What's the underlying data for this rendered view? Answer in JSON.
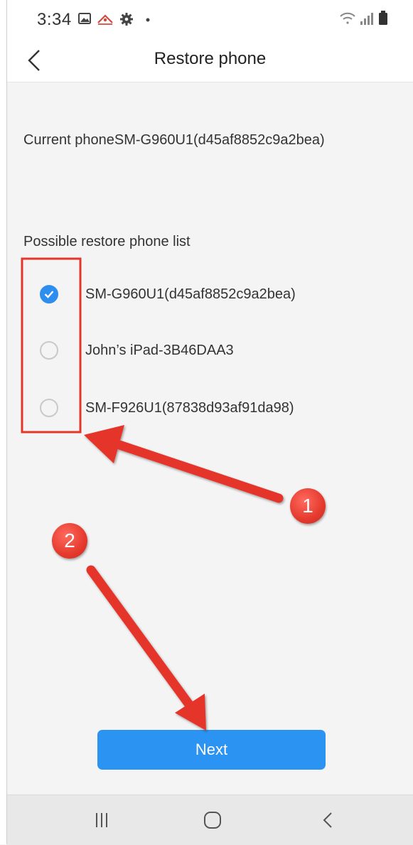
{
  "status_bar": {
    "time": "3:34",
    "left_icons": [
      "gallery-icon",
      "notification-icon",
      "settings-gear-icon",
      "dot-icon"
    ],
    "right_icons": [
      "wifi-icon",
      "signal-icon",
      "battery-icon"
    ]
  },
  "header": {
    "title": "Restore phone",
    "back_icon": "chevron-left-icon"
  },
  "current_phone": {
    "text": "Current phoneSM-G960U1(d45af8852c9a2bea)"
  },
  "restore_list": {
    "label": "Possible restore phone list",
    "options": [
      {
        "label": "SM-G960U1(d45af8852c9a2bea)",
        "checked": true
      },
      {
        "label": "John’s iPad-3B46DAA3",
        "checked": false
      },
      {
        "label": "SM-F926U1(87838d93af91da98)",
        "checked": false
      }
    ]
  },
  "next_button": {
    "label": "Next"
  },
  "nav_bar": {
    "buttons": [
      "recent-apps-icon",
      "home-icon",
      "back-icon"
    ]
  },
  "annotations": {
    "badge_1": "1",
    "badge_2": "2",
    "color": "#e5362c"
  },
  "colors": {
    "accent": "#2b93f2",
    "background": "#f4f4f4"
  }
}
